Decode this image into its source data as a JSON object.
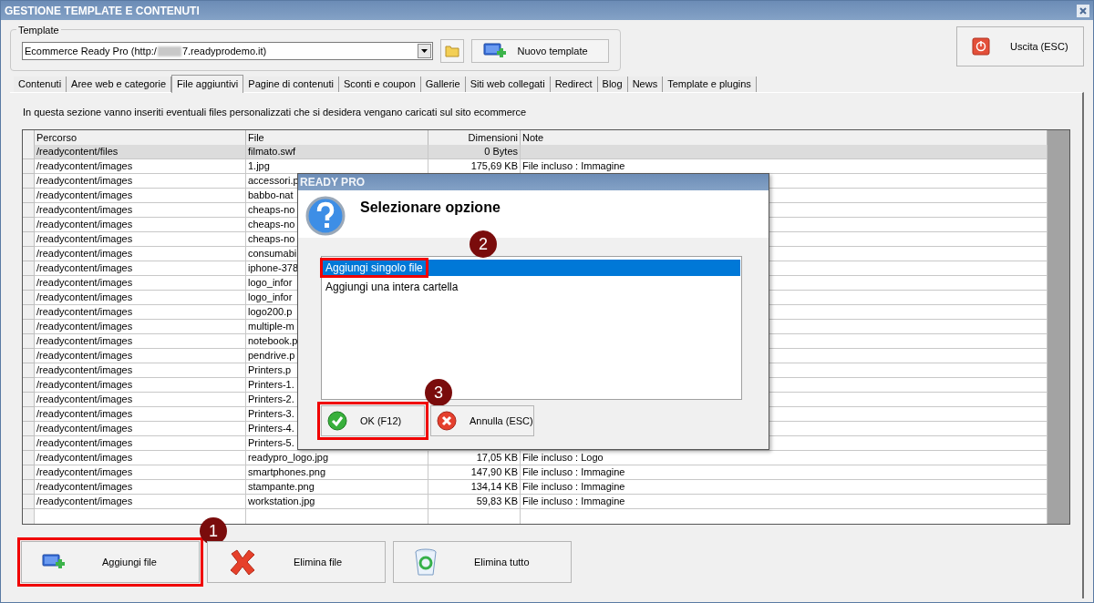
{
  "window": {
    "title": "GESTIONE TEMPLATE E CONTENUTI"
  },
  "template": {
    "legend": "Template",
    "value_start": "Ecommerce Ready Pro (http:/",
    "value_end": "7.readyprodemo.it)",
    "new_button": "Nuovo template"
  },
  "exit_button": "Uscita (ESC)",
  "tabs": [
    {
      "label": "Contenuti",
      "selected": false
    },
    {
      "label": "Aree web e categorie",
      "selected": false
    },
    {
      "label": "File aggiuntivi",
      "selected": true
    },
    {
      "label": "Pagine di contenuti",
      "selected": false
    },
    {
      "label": "Sconti e coupon",
      "selected": false
    },
    {
      "label": "Gallerie",
      "selected": false
    },
    {
      "label": "Siti web collegati",
      "selected": false
    },
    {
      "label": "Redirect",
      "selected": false
    },
    {
      "label": "Blog",
      "selected": false
    },
    {
      "label": "News",
      "selected": false
    },
    {
      "label": "Template e plugins",
      "selected": false
    }
  ],
  "description": "In questa sezione vanno inseriti eventuali files personalizzati che si desidera vengano caricati sul sito ecommerce",
  "table": {
    "columns": [
      "Percorso",
      "File",
      "Dimensioni",
      "Note"
    ],
    "rows": [
      {
        "path": "/readycontent/files",
        "file": "filmato.swf",
        "size": "0 Bytes",
        "note": "",
        "selected": true
      },
      {
        "path": "/readycontent/images",
        "file": "1.jpg",
        "size": "175,69 KB",
        "note": "File incluso : Immagine",
        "selected": false
      },
      {
        "path": "/readycontent/images",
        "file": "accessori.p",
        "size": "",
        "note": "",
        "selected": false
      },
      {
        "path": "/readycontent/images",
        "file": "babbo-nat",
        "size": "",
        "note": "",
        "selected": false
      },
      {
        "path": "/readycontent/images",
        "file": "cheaps-no",
        "size": "",
        "note": "",
        "selected": false
      },
      {
        "path": "/readycontent/images",
        "file": "cheaps-no",
        "size": "",
        "note": "",
        "selected": false
      },
      {
        "path": "/readycontent/images",
        "file": "cheaps-no",
        "size": "",
        "note": "",
        "selected": false
      },
      {
        "path": "/readycontent/images",
        "file": "consumabi",
        "size": "",
        "note": "",
        "selected": false
      },
      {
        "path": "/readycontent/images",
        "file": "iphone-378",
        "size": "",
        "note": "",
        "selected": false
      },
      {
        "path": "/readycontent/images",
        "file": "logo_infor",
        "size": "",
        "note": "",
        "selected": false
      },
      {
        "path": "/readycontent/images",
        "file": "logo_infor",
        "size": "",
        "note": "",
        "selected": false
      },
      {
        "path": "/readycontent/images",
        "file": "logo200.p",
        "size": "",
        "note": "",
        "selected": false
      },
      {
        "path": "/readycontent/images",
        "file": "multiple-m",
        "size": "",
        "note": "",
        "selected": false
      },
      {
        "path": "/readycontent/images",
        "file": "notebook.p",
        "size": "",
        "note": "",
        "selected": false
      },
      {
        "path": "/readycontent/images",
        "file": "pendrive.p",
        "size": "",
        "note": "",
        "selected": false
      },
      {
        "path": "/readycontent/images",
        "file": "Printers.p",
        "size": "",
        "note": "",
        "selected": false
      },
      {
        "path": "/readycontent/images",
        "file": "Printers-1.",
        "size": "",
        "note": "",
        "selected": false
      },
      {
        "path": "/readycontent/images",
        "file": "Printers-2.",
        "size": "",
        "note": "",
        "selected": false
      },
      {
        "path": "/readycontent/images",
        "file": "Printers-3.",
        "size": "",
        "note": "",
        "selected": false
      },
      {
        "path": "/readycontent/images",
        "file": "Printers-4.",
        "size": "",
        "note": "",
        "selected": false
      },
      {
        "path": "/readycontent/images",
        "file": "Printers-5.",
        "size": "",
        "note": "",
        "selected": false
      },
      {
        "path": "/readycontent/images",
        "file": "readypro_logo.jpg",
        "size": "17,05 KB",
        "note": "File incluso : Logo",
        "selected": false
      },
      {
        "path": "/readycontent/images",
        "file": "smartphones.png",
        "size": "147,90 KB",
        "note": "File incluso : Immagine",
        "selected": false
      },
      {
        "path": "/readycontent/images",
        "file": "stampante.png",
        "size": "134,14 KB",
        "note": "File incluso : Immagine",
        "selected": false
      },
      {
        "path": "/readycontent/images",
        "file": "workstation.jpg",
        "size": "59,83 KB",
        "note": "File incluso : Immagine",
        "selected": false
      }
    ]
  },
  "buttons": [
    {
      "kind": "add",
      "label": "Aggiungi file",
      "highlighted": true,
      "callout": "1"
    },
    {
      "kind": "delete",
      "label": "Elimina file",
      "highlighted": false
    },
    {
      "kind": "delete_all",
      "label": "Elimina tutto",
      "highlighted": false
    }
  ],
  "dialog": {
    "title": "READY PRO",
    "heading": "Selezionare opzione",
    "options": [
      {
        "label": "Aggiungi singolo file",
        "selected": true,
        "highlighted": true,
        "callout": "2"
      },
      {
        "label": "Aggiungi una intera cartella",
        "selected": false,
        "highlighted": false
      }
    ],
    "buttons": [
      {
        "kind": "ok",
        "label": "OK (F12)",
        "highlighted": true,
        "callout": "3"
      },
      {
        "kind": "cancel",
        "label": "Annulla (ESC)",
        "highlighted": false
      }
    ]
  }
}
